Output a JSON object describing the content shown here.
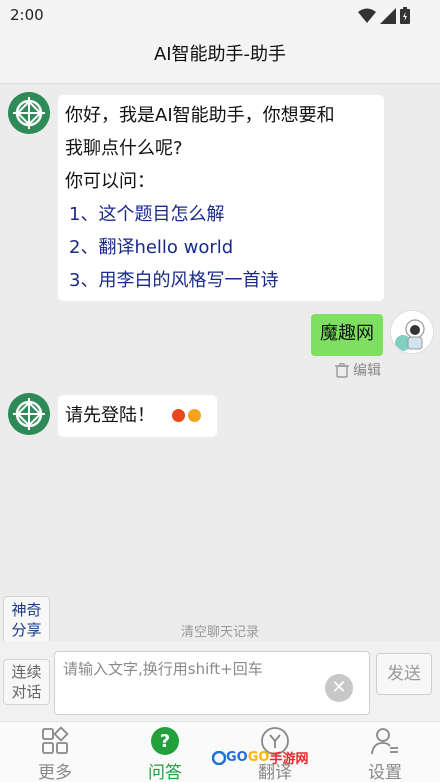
{
  "status": {
    "time": "2:00"
  },
  "header": {
    "title": "AI智能助手-助手"
  },
  "messages": {
    "greeting": {
      "line1": "你好，我是AI智能助手，你想要和",
      "line2": "我聊点什么呢?",
      "line3": "你可以问：",
      "suggestions": [
        "1、这个题目怎么解",
        "2、翻译hello world",
        "3、用李白的风格写一首诗"
      ]
    },
    "user": {
      "text": "魔趣网",
      "edit_label": "编辑"
    },
    "reply": {
      "text": "请先登陆！"
    }
  },
  "side": {
    "share_line1": "神奇",
    "share_line2": "分享",
    "continuous_line1": "连续",
    "continuous_line2": "对话"
  },
  "clear_history": "清空聊天记录",
  "input": {
    "placeholder": "请输入文字,换行用shift+回车"
  },
  "send_label": "发送",
  "tabs": [
    "更多",
    "问答",
    "翻译",
    "设置"
  ],
  "watermark": {
    "part1": "GO",
    "part2": "GO",
    "part3": "手游网"
  },
  "colors": {
    "accent": "#22a03c",
    "user_bubble": "#7ee060",
    "link": "#1a2a8a",
    "dot1": "#e8481c",
    "dot2": "#f7a21b"
  }
}
